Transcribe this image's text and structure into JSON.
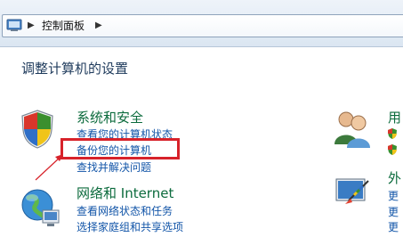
{
  "address_bar": {
    "path": "控制面板"
  },
  "page_title": "调整计算机的设置",
  "categories": {
    "system_security": {
      "title": "系统和安全",
      "links": [
        "查看您的计算机状态",
        "备份您的计算机",
        "查找并解决问题"
      ]
    },
    "network": {
      "title": "网络和 Internet",
      "links": [
        "查看网络状态和任务",
        "选择家庭组和共享选项"
      ]
    },
    "user_accounts": {
      "title": "用"
    },
    "appearance": {
      "title": "外",
      "links": [
        "更",
        "更",
        "更"
      ]
    }
  },
  "colors": {
    "category_title": "#0c6b3d",
    "link": "#1255a8",
    "highlight_box": "#d7222a"
  }
}
